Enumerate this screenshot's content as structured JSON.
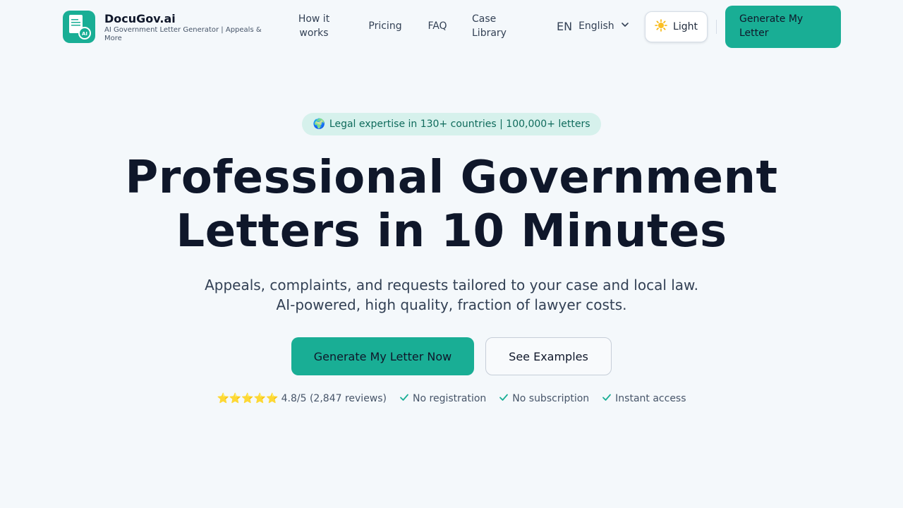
{
  "header": {
    "brand_name": "DocuGov.ai",
    "brand_tagline": "AI Government Letter Generator | Appeals & More",
    "logo_badge": "AI",
    "nav": {
      "how_it_works": "How it works",
      "pricing": "Pricing",
      "faq": "FAQ",
      "case_library": "Case Library"
    },
    "language": {
      "code": "EN",
      "label": "English"
    },
    "theme_toggle": {
      "label": "Light",
      "icon": "sun-icon"
    },
    "cta_label": "Generate My Letter"
  },
  "hero": {
    "badge_icon": "🌍",
    "badge_text": "Legal expertise in 130+ countries | 100,000+ letters",
    "headline_line1": "Professional Government",
    "headline_line2": "Letters in 10 Minutes",
    "subhead": "Appeals, complaints, and requests tailored to your case and local law. AI-powered, high quality, fraction of lawyer costs.",
    "primary_button": "Generate My Letter Now",
    "secondary_button": "See Examples"
  },
  "trust": {
    "stars": "⭐⭐⭐⭐⭐",
    "rating_text": "4.8/5 (2,847 reviews)",
    "items": [
      "No registration",
      "No subscription",
      "Instant access"
    ]
  },
  "colors": {
    "accent": "#19ae95",
    "background": "#f4f8fb",
    "badge_bg": "#d6f1ec",
    "heading": "#0f172a"
  }
}
